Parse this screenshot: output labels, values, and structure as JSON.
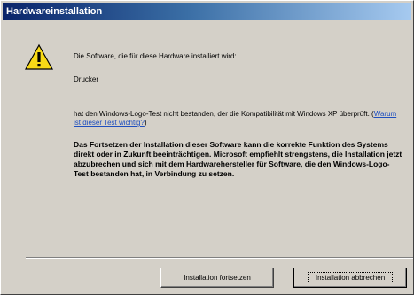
{
  "window": {
    "title": "Hardwareinstallation"
  },
  "icon": "warning-triangle-icon",
  "message": {
    "line1": "Die Software, die für diese Hardware installiert wird:",
    "device": "Drucker",
    "logo_test_prefix": "hat den Windows-Logo-Test nicht bestanden, der die Kompatibilität mit Windows XP überprüft. (",
    "logo_test_link": "Warum ist dieser Test wichtig?",
    "logo_test_suffix": ")",
    "warning": "Das Fortsetzen der Installation dieser Software kann die korrekte Funktion des Systems direkt oder in Zukunft beeinträchtigen. Microsoft empfiehlt strengstens, die Installation jetzt abzubrechen und sich mit dem Hardwarehersteller für Software, die den Windows-Logo-Test bestanden hat, in Verbindung zu setzen."
  },
  "buttons": {
    "continue": "Installation fortsetzen",
    "cancel": "Installation abbrechen"
  },
  "colors": {
    "titlebar_start": "#0a246a",
    "titlebar_end": "#a6caf0",
    "dialog_bg": "#d4d0c8",
    "link": "#1f4fbf"
  }
}
